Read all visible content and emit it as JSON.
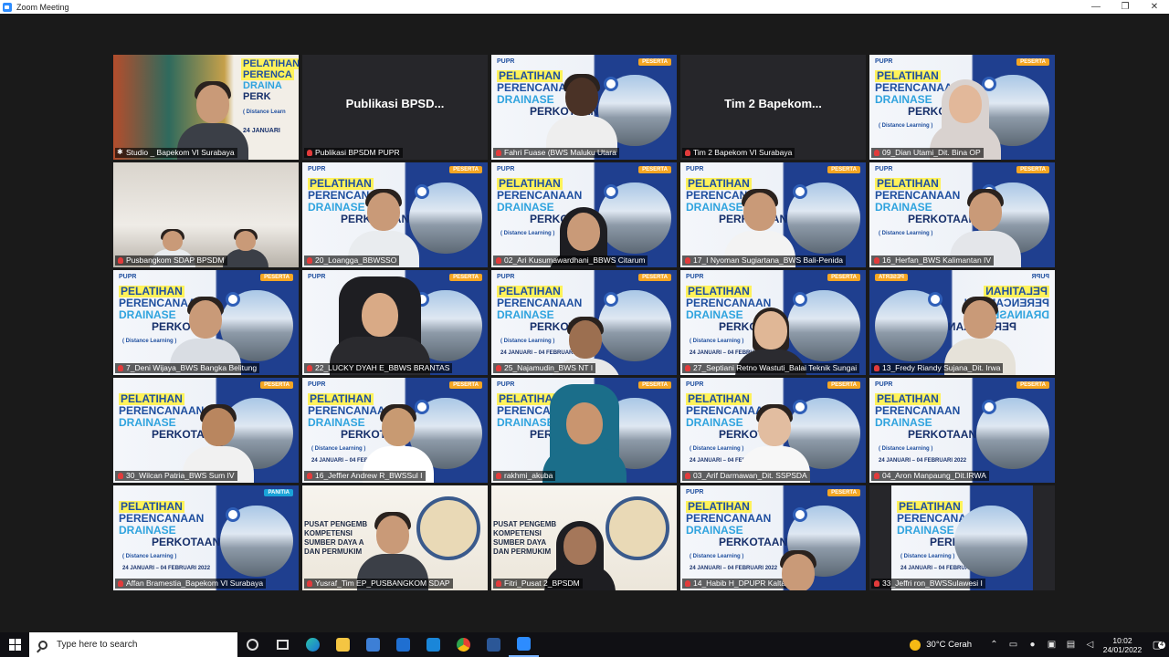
{
  "window": {
    "title": "Zoom Meeting",
    "controls": {
      "minimize": "—",
      "restore": "❐",
      "close": "✕"
    }
  },
  "slide": {
    "logo": "PUPR",
    "badge_peserta": "PESERTA",
    "badge_panitia": "PANITIA",
    "line1": "PELATIHAN",
    "line2": "PERENCANAAN",
    "line3": "DRAINASE",
    "line4": "PERKOTAAN",
    "sub": "( Distance Learning )",
    "date": "24 JANUARI – 04 FEBRUARI 2022"
  },
  "tiles": {
    "studio": {
      "label": "Studio _ Bapekom VI Surabaya",
      "title1": "PELATIHAN",
      "title2": "PERENCA",
      "title3": "DRAINA",
      "title4": "PERK",
      "sub": "( Distance Learn",
      "date": "24 JANUARI"
    },
    "publikasi": {
      "name_text": "Publikasi BPSD...",
      "label": "Publikasi BPSDM PUPR"
    },
    "fahri": {
      "label": "Fahri Fuase (BWS Maluku Utara"
    },
    "tim2": {
      "name_text": "Tim 2 Bapekom...",
      "label": "Tim 2 Bapekom VI Surabaya"
    },
    "dian": {
      "label": "09_Dian Utami_Dit. Bina OP"
    },
    "pusbangkom": {
      "label": "Pusbangkom SDAP BPSDM"
    },
    "loangga": {
      "label": "20_Loangga_BBWSSO"
    },
    "ari": {
      "label": "02_Ari Kusumawardhani_BBWS Citarum"
    },
    "nyoman": {
      "label": "17_I Nyoman Sugiartana_BWS Bali-Penida"
    },
    "herfan": {
      "label": "16_Herfan_BWS Kalimantan IV"
    },
    "deni": {
      "label": "7_Deni Wijaya_BWS Bangka Belitung"
    },
    "lucky": {
      "label": "22_LUCKY DYAH E_BBWS BRANTAS"
    },
    "najamudin": {
      "label": "25_Najamudin_BWS NT I"
    },
    "septiani": {
      "label": "27_Septiani Retno Wastuti_Balai Teknik Sungai"
    },
    "fredy": {
      "label": "13_Fredy Riandy Sujana_Dit. Irwa"
    },
    "wilcan": {
      "label": "30_Wilcan Patria_BWS Sum IV"
    },
    "jeffier": {
      "label": "16_Jeffier Andrew R_BWSSul I"
    },
    "rakhmi": {
      "label": "rakhmi_akuba"
    },
    "arif": {
      "label": "03_Arif Darmawan_Dit. SSPSDA"
    },
    "aron": {
      "label": "04_Aron Manpaung_Dit.IRWA"
    },
    "affan": {
      "label": "Affan Bramestia_Bapekom VI Surabaya"
    },
    "yusraf": {
      "label": "Yusraf_Tim EP_PUSBANGKOM SDAP",
      "pusat1": "PUSAT PENGEMB",
      "pusat2": "KOMPETENSI",
      "pusat3": "SUMBER DAYA A",
      "pusat4": "DAN PERMUKIM"
    },
    "fitri": {
      "label": "Fitri_Pusat 2_BPSDM",
      "pusat1": "PUSAT PENGEMB",
      "pusat2": "KOMPETENSI",
      "pusat3": "SUMBER DAYA",
      "pusat4": "DAN PERMUKIM"
    },
    "habib": {
      "label": "14_Habib H_DPUPR Kaltara"
    },
    "jeffri": {
      "label": "33_Jeffri ron_BWSSulawesi I"
    }
  },
  "taskbar": {
    "search_placeholder": "Type here to search",
    "weather": "30°C  Cerah",
    "time": "10:02",
    "date": "24/01/2022",
    "notifications": "4"
  },
  "colors": {
    "stage_bg": "#1a1a1a",
    "active_speaker_border": "#e8d24a",
    "pupr_blue": "#1f4f9f",
    "peserta_badge": "#f5a623",
    "mic_muted": "#e23b3b"
  }
}
